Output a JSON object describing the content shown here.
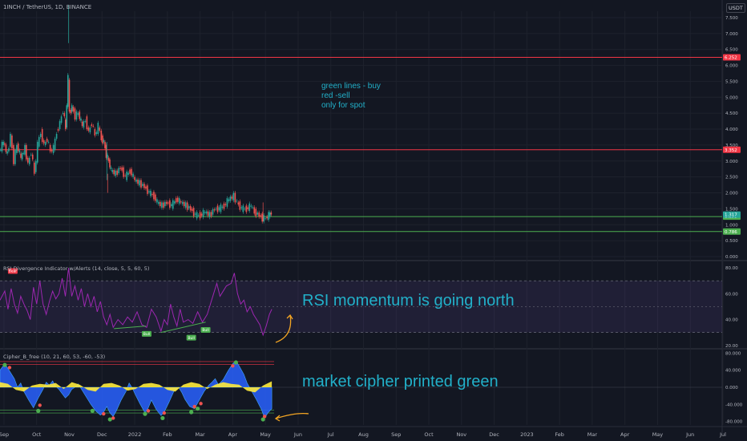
{
  "header": {
    "symbol_title": "1INCH / TetherUS, 1D, BINANCE",
    "currency": "USDT"
  },
  "notes": {
    "strategy_line1": "green lines - buy",
    "strategy_line2": "red -sell",
    "strategy_line3": "only for spot",
    "rsi_note": "RSI momentum is going north",
    "cipher_note": "market cipher printed green"
  },
  "colors": {
    "background": "#131722",
    "sell_line": "#f23645",
    "buy_line": "#4caf50",
    "rsi_line": "#9c27b0",
    "annotation_text": "#22b0c9",
    "arrow": "#f5a623",
    "wave_blue": "#2962ff",
    "money_flow_yellow": "#ffeb3b",
    "candle_up": "#26a69a",
    "candle_down": "#ef5350"
  },
  "chart_data": [
    {
      "type": "candlestick",
      "name": "1INCH / TetherUS, 1D, BINANCE",
      "y_axis_ticks": [
        0.0,
        0.5,
        0.786,
        1.0,
        1.255,
        1.5,
        2.0,
        2.5,
        3.0,
        3.352,
        3.5,
        4.0,
        4.5,
        5.0,
        5.5,
        6.0,
        6.252,
        6.5,
        7.0,
        7.5
      ],
      "y_axis_tick_labels": [
        "0.000",
        "0.500",
        "0.786",
        "1.000",
        "1.255",
        "1.500",
        "2.000",
        "2.500",
        "3.000",
        "3.352",
        "3.500",
        "4.000",
        "4.500",
        "5.000",
        "5.500",
        "6.000",
        "6.252",
        "6.500",
        "7.000",
        "7.500"
      ],
      "ylim": [
        -0.1,
        7.7
      ],
      "x_axis_labels": [
        "Sep",
        "Oct",
        "Nov",
        "Dec",
        "2022",
        "Feb",
        "Mar",
        "Apr",
        "May",
        "Jun",
        "Jul",
        "Aug",
        "Sep",
        "Oct",
        "Nov",
        "Dec",
        "2023",
        "Feb",
        "Mar",
        "Apr",
        "May",
        "Jun",
        "Jul"
      ],
      "price_trace": [
        [
          0,
          3.3
        ],
        [
          5,
          3.6
        ],
        [
          10,
          3.2
        ],
        [
          14,
          3.8
        ],
        [
          18,
          3.0
        ],
        [
          22,
          3.5
        ],
        [
          27,
          3.1
        ],
        [
          32,
          3.4
        ],
        [
          36,
          2.9
        ],
        [
          40,
          3.3
        ],
        [
          44,
          2.6
        ],
        [
          48,
          3.5
        ],
        [
          52,
          3.9
        ],
        [
          56,
          3.5
        ],
        [
          60,
          3.7
        ],
        [
          64,
          3.3
        ],
        [
          68,
          3.4
        ],
        [
          72,
          3.9
        ],
        [
          76,
          4.2
        ],
        [
          80,
          4.6
        ],
        [
          83,
          4.0
        ],
        [
          86,
          5.6
        ],
        [
          88,
          4.5
        ],
        [
          91,
          4.7
        ],
        [
          95,
          4.4
        ],
        [
          99,
          4.5
        ],
        [
          104,
          4.1
        ],
        [
          108,
          4.3
        ],
        [
          112,
          3.9
        ],
        [
          116,
          4.2
        ],
        [
          120,
          3.8
        ],
        [
          124,
          4.1
        ],
        [
          128,
          3.7
        ],
        [
          131,
          3.6
        ],
        [
          134,
          3.2
        ],
        [
          137,
          3.0
        ],
        [
          140,
          2.7
        ],
        [
          146,
          2.6
        ],
        [
          152,
          2.8
        ],
        [
          158,
          2.5
        ],
        [
          164,
          2.7
        ],
        [
          170,
          2.4
        ],
        [
          176,
          2.3
        ],
        [
          182,
          2.2
        ],
        [
          188,
          2.0
        ],
        [
          194,
          1.9
        ],
        [
          198,
          1.7
        ],
        [
          204,
          1.6
        ],
        [
          210,
          1.7
        ],
        [
          216,
          1.6
        ],
        [
          222,
          1.8
        ],
        [
          228,
          1.7
        ],
        [
          234,
          1.6
        ],
        [
          240,
          1.5
        ],
        [
          246,
          1.3
        ],
        [
          252,
          1.3
        ],
        [
          258,
          1.4
        ],
        [
          264,
          1.3
        ],
        [
          270,
          1.5
        ],
        [
          276,
          1.5
        ],
        [
          282,
          1.6
        ],
        [
          288,
          1.8
        ],
        [
          294,
          1.9
        ],
        [
          298,
          1.7
        ],
        [
          304,
          1.5
        ],
        [
          310,
          1.5
        ],
        [
          316,
          1.6
        ],
        [
          320,
          1.4
        ],
        [
          326,
          1.3
        ],
        [
          330,
          1.2
        ],
        [
          334,
          1.2
        ],
        [
          338,
          1.3
        ],
        [
          341,
          1.37
        ]
      ],
      "wick_highs": [
        [
          86,
          7.9
        ],
        [
          134,
          3.6
        ]
      ],
      "wick_lows": [
        [
          135,
          2.0
        ],
        [
          330,
          1.1
        ]
      ],
      "horizontal_levels": [
        {
          "price": 6.252,
          "label": "6.252",
          "color": "red"
        },
        {
          "price": 3.352,
          "label": "3.352",
          "color": "red"
        },
        {
          "price": 1.255,
          "label": "1.255",
          "color": "green"
        },
        {
          "price": 0.786,
          "label": "0.786",
          "color": "green"
        }
      ],
      "current_price": {
        "label": "1.317",
        "value": 1.317
      }
    },
    {
      "type": "line",
      "name": "RSI Divergence Indicator w/Alerts (14, close, 5, 5, 60, 5)",
      "y_axis_ticks": [
        20.0,
        40.0,
        60.0,
        80.0
      ],
      "y_axis_tick_labels": [
        "20.00",
        "40.00",
        "60.00",
        "80.00"
      ],
      "ylim": [
        18,
        85
      ],
      "band": [
        30,
        70
      ],
      "mid_line": 50,
      "values": [
        [
          0,
          55
        ],
        [
          6,
          62
        ],
        [
          10,
          48
        ],
        [
          14,
          64
        ],
        [
          18,
          52
        ],
        [
          22,
          45
        ],
        [
          26,
          58
        ],
        [
          30,
          52
        ],
        [
          34,
          47
        ],
        [
          38,
          40
        ],
        [
          42,
          65
        ],
        [
          46,
          52
        ],
        [
          50,
          70
        ],
        [
          54,
          52
        ],
        [
          58,
          44
        ],
        [
          62,
          54
        ],
        [
          66,
          62
        ],
        [
          70,
          56
        ],
        [
          74,
          60
        ],
        [
          78,
          72
        ],
        [
          82,
          58
        ],
        [
          86,
          80
        ],
        [
          90,
          58
        ],
        [
          94,
          66
        ],
        [
          98,
          55
        ],
        [
          102,
          64
        ],
        [
          106,
          50
        ],
        [
          110,
          60
        ],
        [
          114,
          50
        ],
        [
          118,
          58
        ],
        [
          122,
          46
        ],
        [
          126,
          54
        ],
        [
          130,
          42
        ],
        [
          134,
          36
        ],
        [
          138,
          44
        ],
        [
          142,
          34
        ],
        [
          148,
          40
        ],
        [
          154,
          36
        ],
        [
          160,
          42
        ],
        [
          166,
          38
        ],
        [
          172,
          46
        ],
        [
          178,
          36
        ],
        [
          184,
          34
        ],
        [
          190,
          48
        ],
        [
          196,
          42
        ],
        [
          202,
          31
        ],
        [
          206,
          40
        ],
        [
          210,
          36
        ],
        [
          214,
          52
        ],
        [
          218,
          42
        ],
        [
          222,
          35
        ],
        [
          226,
          48
        ],
        [
          230,
          38
        ],
        [
          236,
          40
        ],
        [
          242,
          37
        ],
        [
          248,
          46
        ],
        [
          254,
          38
        ],
        [
          260,
          44
        ],
        [
          264,
          52
        ],
        [
          268,
          60
        ],
        [
          272,
          68
        ],
        [
          276,
          58
        ],
        [
          280,
          62
        ],
        [
          284,
          66
        ],
        [
          290,
          68
        ],
        [
          294,
          76
        ],
        [
          298,
          60
        ],
        [
          302,
          52
        ],
        [
          306,
          55
        ],
        [
          310,
          46
        ],
        [
          314,
          50
        ],
        [
          318,
          44
        ],
        [
          322,
          40
        ],
        [
          326,
          36
        ],
        [
          330,
          28
        ],
        [
          334,
          35
        ],
        [
          338,
          44
        ],
        [
          341,
          48
        ]
      ],
      "divergence_lines": [
        [
          [
            143,
            33
          ],
          [
            183,
            35
          ]
        ],
        [
          [
            202,
            30
          ],
          [
            258,
            38
          ]
        ]
      ],
      "bull_labels": [
        {
          "x": 184,
          "value": 33,
          "label": "Bull"
        },
        {
          "x": 240,
          "value": 30,
          "label": "Bull"
        },
        {
          "x": 258,
          "value": 36,
          "label": "Bull"
        }
      ],
      "bear_labels": [
        {
          "x": 16,
          "value": 76,
          "label": "Bear"
        }
      ]
    },
    {
      "type": "area",
      "name": "Cipher_B_free (10, 21, 60, 53, -60, -53)",
      "y_axis_ticks": [
        -80.0,
        -40.0,
        0.0,
        40.0,
        80.0
      ],
      "y_axis_tick_labels": [
        "-80.000",
        "-40.000",
        "0.000",
        "40.000",
        "80.000"
      ],
      "ylim": [
        -88,
        88
      ],
      "overbought_lines": [
        53,
        60
      ],
      "oversold_lines": [
        -53,
        -60
      ],
      "wave": [
        [
          0,
          40
        ],
        [
          6,
          55
        ],
        [
          12,
          38
        ],
        [
          18,
          20
        ],
        [
          22,
          0
        ],
        [
          26,
          10
        ],
        [
          30,
          -10
        ],
        [
          36,
          -30
        ],
        [
          42,
          -48
        ],
        [
          48,
          -25
        ],
        [
          54,
          -5
        ],
        [
          58,
          12
        ],
        [
          62,
          5
        ],
        [
          66,
          15
        ],
        [
          70,
          2
        ],
        [
          74,
          -5
        ],
        [
          78,
          -15
        ],
        [
          82,
          -25
        ],
        [
          86,
          -18
        ],
        [
          90,
          -5
        ],
        [
          94,
          0
        ],
        [
          98,
          8
        ],
        [
          102,
          -4
        ],
        [
          108,
          -22
        ],
        [
          114,
          -40
        ],
        [
          120,
          -55
        ],
        [
          126,
          -65
        ],
        [
          130,
          -58
        ],
        [
          134,
          -45
        ],
        [
          138,
          -60
        ],
        [
          142,
          -68
        ],
        [
          146,
          -55
        ],
        [
          152,
          -30
        ],
        [
          158,
          -10
        ],
        [
          162,
          10
        ],
        [
          166,
          -2
        ],
        [
          170,
          -18
        ],
        [
          176,
          -40
        ],
        [
          182,
          -60
        ],
        [
          186,
          -48
        ],
        [
          190,
          -30
        ],
        [
          196,
          -52
        ],
        [
          202,
          -66
        ],
        [
          206,
          -58
        ],
        [
          212,
          -35
        ],
        [
          218,
          -10
        ],
        [
          224,
          0
        ],
        [
          228,
          -12
        ],
        [
          232,
          -28
        ],
        [
          238,
          -45
        ],
        [
          244,
          -50
        ],
        [
          250,
          -30
        ],
        [
          256,
          -10
        ],
        [
          262,
          5
        ],
        [
          266,
          12
        ],
        [
          270,
          20
        ],
        [
          274,
          6
        ],
        [
          280,
          18
        ],
        [
          286,
          38
        ],
        [
          292,
          55
        ],
        [
          296,
          62
        ],
        [
          300,
          50
        ],
        [
          306,
          30
        ],
        [
          310,
          10
        ],
        [
          316,
          -10
        ],
        [
          322,
          -30
        ],
        [
          328,
          -52
        ],
        [
          332,
          -72
        ],
        [
          336,
          -60
        ],
        [
          341,
          -50
        ]
      ],
      "money_flow": [
        [
          0,
          12
        ],
        [
          10,
          8
        ],
        [
          20,
          -6
        ],
        [
          30,
          -10
        ],
        [
          40,
          4
        ],
        [
          50,
          8
        ],
        [
          60,
          6
        ],
        [
          70,
          10
        ],
        [
          80,
          -4
        ],
        [
          90,
          12
        ],
        [
          100,
          6
        ],
        [
          110,
          -6
        ],
        [
          120,
          -10
        ],
        [
          130,
          8
        ],
        [
          140,
          10
        ],
        [
          150,
          4
        ],
        [
          160,
          -8
        ],
        [
          170,
          -4
        ],
        [
          180,
          8
        ],
        [
          190,
          10
        ],
        [
          200,
          6
        ],
        [
          210,
          -6
        ],
        [
          220,
          -10
        ],
        [
          230,
          6
        ],
        [
          240,
          12
        ],
        [
          250,
          8
        ],
        [
          260,
          -4
        ],
        [
          270,
          6
        ],
        [
          280,
          12
        ],
        [
          290,
          8
        ],
        [
          300,
          6
        ],
        [
          310,
          -8
        ],
        [
          320,
          -12
        ],
        [
          330,
          4
        ],
        [
          341,
          14
        ]
      ],
      "green_dots": [
        [
          6,
          52
        ],
        [
          48,
          -55
        ],
        [
          116,
          -55
        ],
        [
          138,
          -75
        ],
        [
          182,
          -62
        ],
        [
          204,
          -72
        ],
        [
          240,
          -58
        ],
        [
          248,
          -50
        ],
        [
          296,
          58
        ],
        [
          330,
          -75
        ]
      ],
      "red_dots": [
        [
          12,
          46
        ],
        [
          50,
          -42
        ],
        [
          130,
          -62
        ],
        [
          142,
          -72
        ],
        [
          186,
          -55
        ],
        [
          206,
          -60
        ],
        [
          244,
          -45
        ],
        [
          252,
          -38
        ],
        [
          292,
          50
        ],
        [
          332,
          -68
        ]
      ]
    }
  ]
}
